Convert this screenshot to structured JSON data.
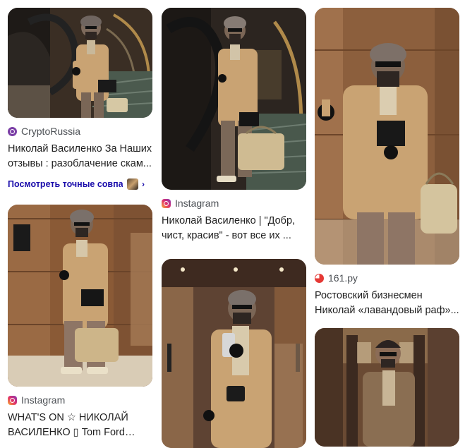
{
  "results": [
    {
      "source": "CryptoRussia",
      "source_icon": "cryptorussia-icon",
      "title": "Николай Василенко За Наших отзывы : разоблачение скам...",
      "match_link": "Посмотреть точные совпа..."
    },
    {
      "source": "Instagram",
      "source_icon": "instagram-icon",
      "title": "WHAT'S ON ☆ НИКОЛАЙ ВАСИЛЕНКО ▯ Tom Ford GIN..."
    },
    {
      "source": "Instagram",
      "source_icon": "instagram-icon",
      "title": "Николай Василенко | \"Добр, чист, красив\" - вот все их ..."
    },
    {
      "source": "161.ру",
      "source_icon": "161ru-icon",
      "title": "Ростовский бизнесмен Николай «лавандовый раф»..."
    }
  ],
  "colors": {
    "link_blue": "#1a0dab",
    "coat_beige": "#c9a373",
    "wood": "#8a5a36"
  }
}
